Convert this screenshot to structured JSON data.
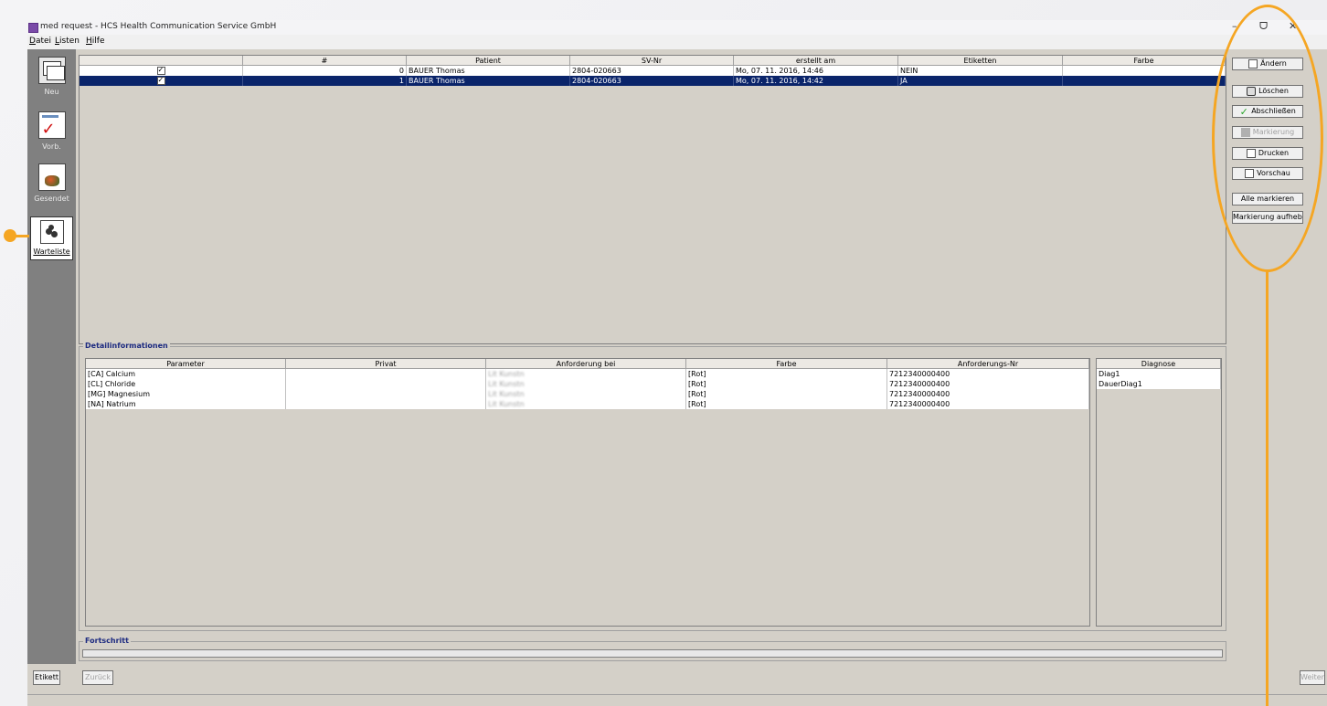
{
  "window": {
    "title": "med request - HCS Health Communication Service GmbH",
    "min_glyph": "–",
    "restore_glyph": "ᗜ",
    "close_glyph": "✕"
  },
  "menu": [
    {
      "pre": "",
      "key": "D",
      "post": "atei"
    },
    {
      "pre": "",
      "key": "L",
      "post": "isten"
    },
    {
      "pre": "",
      "key": "H",
      "post": "ilfe"
    }
  ],
  "sidebar": {
    "items": [
      {
        "label": "Neu",
        "icon": "documents-icon"
      },
      {
        "label": "Vorb.",
        "icon": "checklist-icon"
      },
      {
        "label": "Gesendet",
        "icon": "sent-icon"
      },
      {
        "label": "Warteliste",
        "icon": "waitlist-icon",
        "active": true
      }
    ]
  },
  "request_table": {
    "columns": [
      "",
      "#",
      "Patient",
      "SV-Nr",
      "erstellt am",
      "Etiketten",
      "Farbe"
    ],
    "rows": [
      {
        "checked": true,
        "num": "0",
        "patient": "BAUER Thomas",
        "svnr": "2804-020663",
        "created": "Mo, 07. 11. 2016, 14:46",
        "labels": "NEIN",
        "color": "",
        "selected": false
      },
      {
        "checked": true,
        "num": "1",
        "patient": "BAUER Thomas",
        "svnr": "2804-020663",
        "created": "Mo, 07. 11. 2016, 14:42",
        "labels": "JA",
        "color": "",
        "selected": true
      }
    ]
  },
  "detail": {
    "title": "Detailinformationen",
    "columns": [
      "Parameter",
      "Privat",
      "Anforderung bei",
      "Farbe",
      "Anforderungs-Nr"
    ],
    "rows": [
      {
        "param": "[CA] Calcium",
        "privat": "",
        "bei": "Lit Kunstn",
        "farbe": "[Rot]",
        "nr": "7212340000400"
      },
      {
        "param": "[CL] Chloride",
        "privat": "",
        "bei": "Lit Kunstn",
        "farbe": "[Rot]",
        "nr": "7212340000400"
      },
      {
        "param": "[MG] Magnesium",
        "privat": "",
        "bei": "Lit Kunstn",
        "farbe": "[Rot]",
        "nr": "7212340000400"
      },
      {
        "param": "[NA] Natrium",
        "privat": "",
        "bei": "Lit Kunstn",
        "farbe": "[Rot]",
        "nr": "7212340000400"
      }
    ],
    "diag_header": "Diagnose",
    "diag_rows": [
      "Diag1",
      "DauerDiag1"
    ]
  },
  "progress": {
    "title": "Fortschritt",
    "value": 0
  },
  "actions": [
    {
      "label": "Ändern",
      "icon": "edit-icon",
      "enabled": true
    },
    {
      "label": "Löschen",
      "icon": "delete-icon",
      "enabled": true
    },
    {
      "label": "Abschließen",
      "icon": "check-icon",
      "enabled": true
    },
    {
      "label": "Markierung",
      "icon": "marker-icon",
      "enabled": false
    },
    {
      "label": "Drucken",
      "icon": "printer-icon",
      "enabled": true
    },
    {
      "label": "Vorschau",
      "icon": "preview-icon",
      "enabled": true
    },
    {
      "label": "Alle markieren",
      "icon": "",
      "enabled": true
    },
    {
      "label": "Markierung aufheben",
      "icon": "",
      "enabled": true
    }
  ],
  "bottom": {
    "etikett": "Etikett",
    "back": "Zurück",
    "next": "Weiter"
  },
  "colors": {
    "accent": "#f5a623",
    "selection": "#0a246a",
    "sidebar": "#808080",
    "face": "#d4d0c8"
  }
}
